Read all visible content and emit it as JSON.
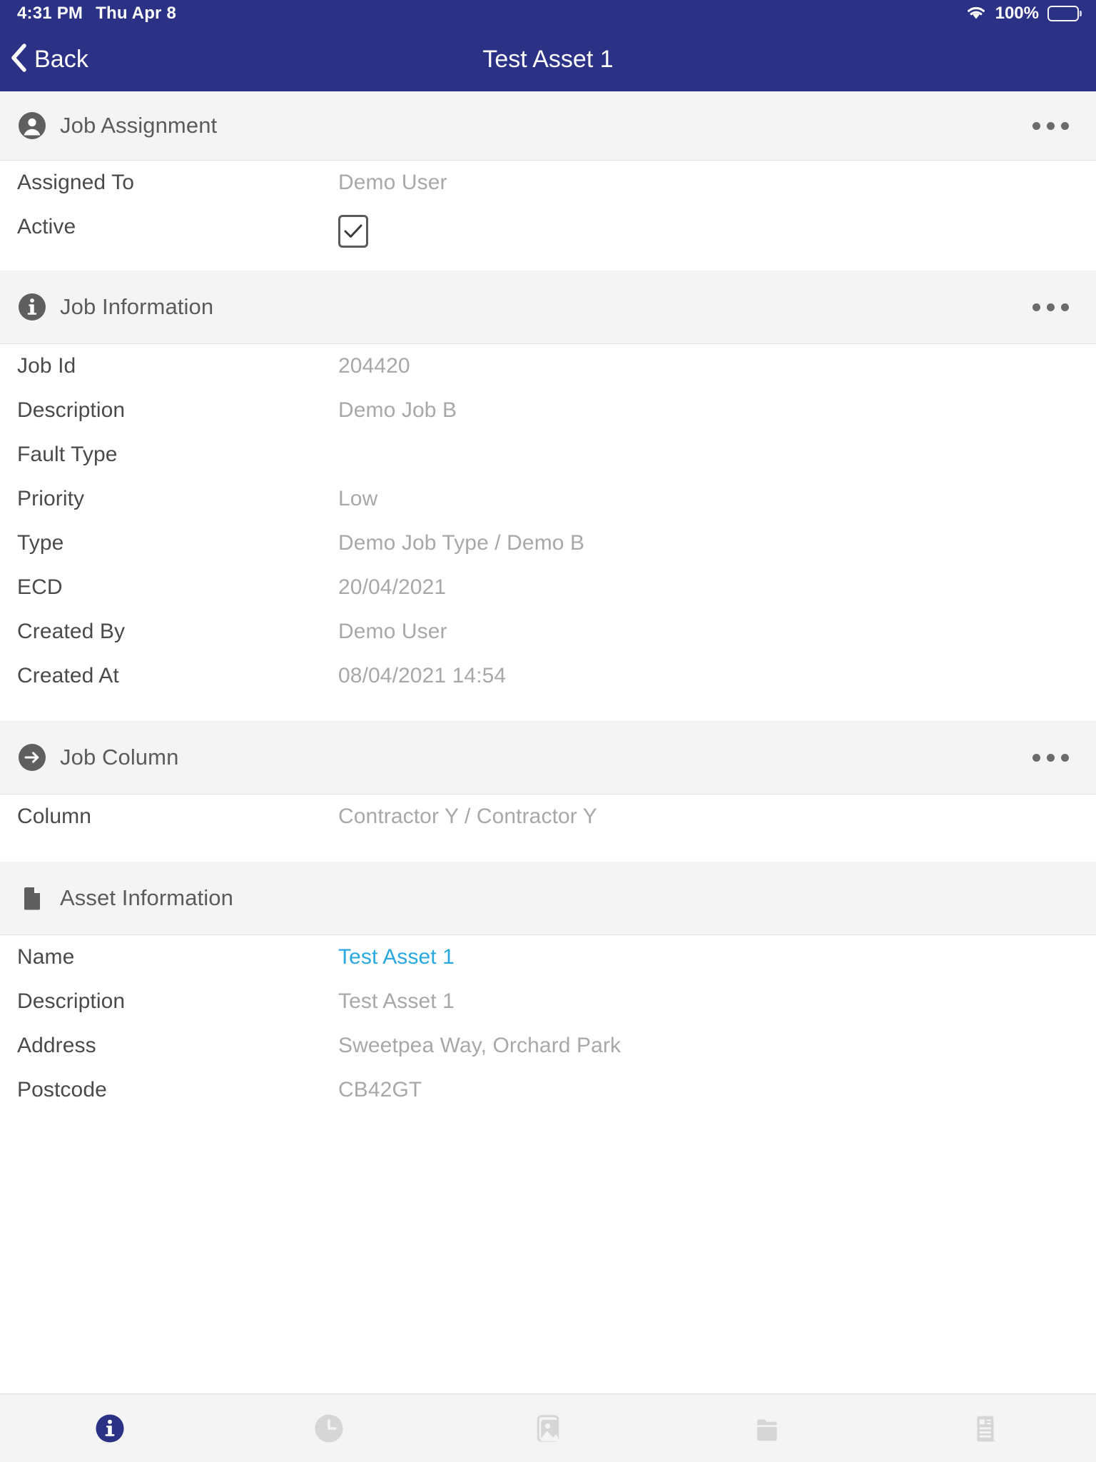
{
  "statusbar": {
    "time": "4:31 PM",
    "date": "Thu Apr 8",
    "battery_percent": "100%",
    "wifi_icon": "wifi-icon",
    "battery_icon": "battery-full-icon"
  },
  "navbar": {
    "back_label": "Back",
    "back_icon": "chevron-left-icon",
    "title": "Test Asset 1"
  },
  "colors": {
    "nav_background": "#2b3184",
    "section_background": "#f4f4f4",
    "label_text": "#4a4a4a",
    "value_text": "#a8a8a8",
    "link": "#29a8e0",
    "active_tab": "#2b3184"
  },
  "sections": [
    {
      "id": "job-assignment",
      "title": "Job Assignment",
      "icon": "person-icon",
      "has_menu": true,
      "menu_icon": "ellipsis-icon",
      "rows": [
        {
          "label": "Assigned To",
          "value": "Demo User",
          "type": "text"
        },
        {
          "label": "Active",
          "value": "",
          "type": "checkbox",
          "checked": true
        }
      ]
    },
    {
      "id": "job-information",
      "title": "Job Information",
      "icon": "info-circle-icon",
      "has_menu": true,
      "menu_icon": "ellipsis-icon",
      "rows": [
        {
          "label": "Job Id",
          "value": "204420",
          "type": "text"
        },
        {
          "label": "Description",
          "value": "Demo Job B",
          "type": "text"
        },
        {
          "label": "Fault Type",
          "value": "",
          "type": "text"
        },
        {
          "label": "Priority",
          "value": "Low",
          "type": "text"
        },
        {
          "label": "Type",
          "value": "Demo Job Type / Demo B",
          "type": "text"
        },
        {
          "label": "ECD",
          "value": "20/04/2021",
          "type": "text"
        },
        {
          "label": "Created By",
          "value": "Demo User",
          "type": "text"
        },
        {
          "label": "Created At",
          "value": "08/04/2021 14:54",
          "type": "text"
        }
      ]
    },
    {
      "id": "job-column",
      "title": "Job Column",
      "icon": "arrow-right-circle-icon",
      "has_menu": true,
      "menu_icon": "ellipsis-icon",
      "rows": [
        {
          "label": "Column",
          "value": "Contractor Y / Contractor Y",
          "type": "text"
        }
      ]
    },
    {
      "id": "asset-information",
      "title": "Asset Information",
      "icon": "document-icon",
      "has_menu": false,
      "rows": [
        {
          "label": "Name",
          "value": "Test Asset 1",
          "type": "link"
        },
        {
          "label": "Description",
          "value": "Test Asset 1",
          "type": "text"
        },
        {
          "label": "Address",
          "value": "Sweetpea Way, Orchard Park",
          "type": "text"
        },
        {
          "label": "Postcode",
          "value": "CB42GT",
          "type": "text"
        }
      ]
    }
  ],
  "tabbar": {
    "tabs": [
      {
        "id": "info",
        "icon": "info-circle-icon",
        "active": true
      },
      {
        "id": "history",
        "icon": "clock-icon",
        "active": false
      },
      {
        "id": "photos",
        "icon": "image-icon",
        "active": false
      },
      {
        "id": "files",
        "icon": "folder-icon",
        "active": false
      },
      {
        "id": "notes",
        "icon": "article-icon",
        "active": false
      }
    ]
  }
}
